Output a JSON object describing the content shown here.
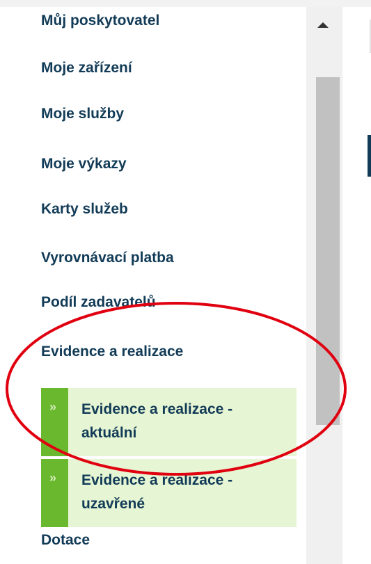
{
  "sidebar": {
    "items": [
      {
        "label": "Můj poskytovatel"
      },
      {
        "label": "Moje zařízení"
      },
      {
        "label": "Moje služby"
      },
      {
        "label": "Moje výkazy"
      },
      {
        "label": "Karty služeb"
      },
      {
        "label": "Vyrovnávací platba"
      },
      {
        "label": "Podíl zadavatelů"
      },
      {
        "label": "Evidence a realizace"
      }
    ],
    "subitems": [
      {
        "label": "Evidence a realizace - aktuální",
        "icon": "chevron-double-right-icon"
      },
      {
        "label": "Evidence a realizace - uzavřené",
        "icon": "chevron-double-right-icon"
      }
    ],
    "last_item": {
      "label": "Dotace"
    }
  },
  "colors": {
    "text": "#123b57",
    "submenu_bg": "#e6f5d3",
    "submenu_bar": "#69b82e",
    "annotation": "#e0000f"
  }
}
